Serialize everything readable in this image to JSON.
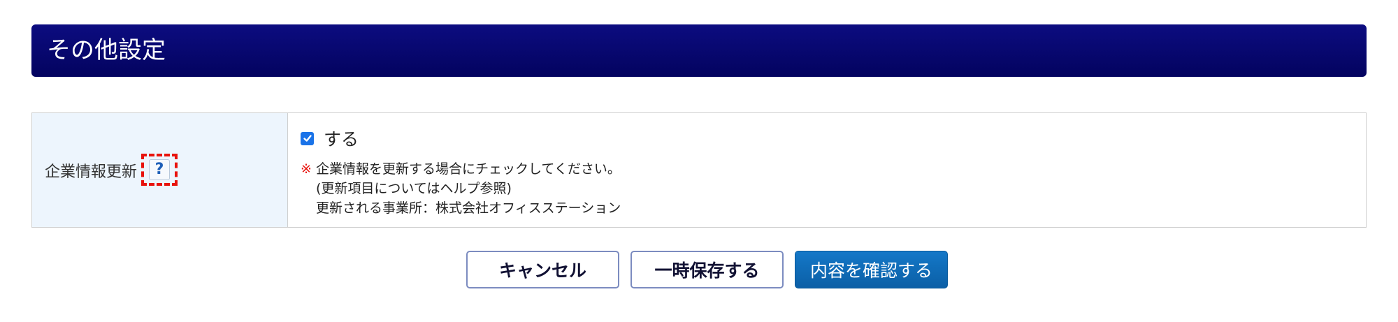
{
  "section": {
    "title": "その他設定"
  },
  "company_info_row": {
    "label": "企業情報更新",
    "help_symbol": "?",
    "checkbox_label": "する",
    "checkbox_checked": true,
    "note_mark": "※",
    "note_line1": "企業情報を更新する場合にチェックしてください。",
    "note_line2": "(更新項目についてはヘルプ参照)",
    "note_line3": "更新される事業所：株式会社オフィスステーション"
  },
  "buttons": {
    "cancel": "キャンセル",
    "save_draft": "一時保存する",
    "confirm": "内容を確認する"
  },
  "colors": {
    "header_bg": "#03035f",
    "label_bg": "#edf5fd",
    "accent_blue": "#1a73e8",
    "alert_red": "#e8120c",
    "primary_button": "#0b5fa6"
  },
  "icons": {
    "help": "question-mark-icon",
    "check": "checkmark-icon"
  }
}
